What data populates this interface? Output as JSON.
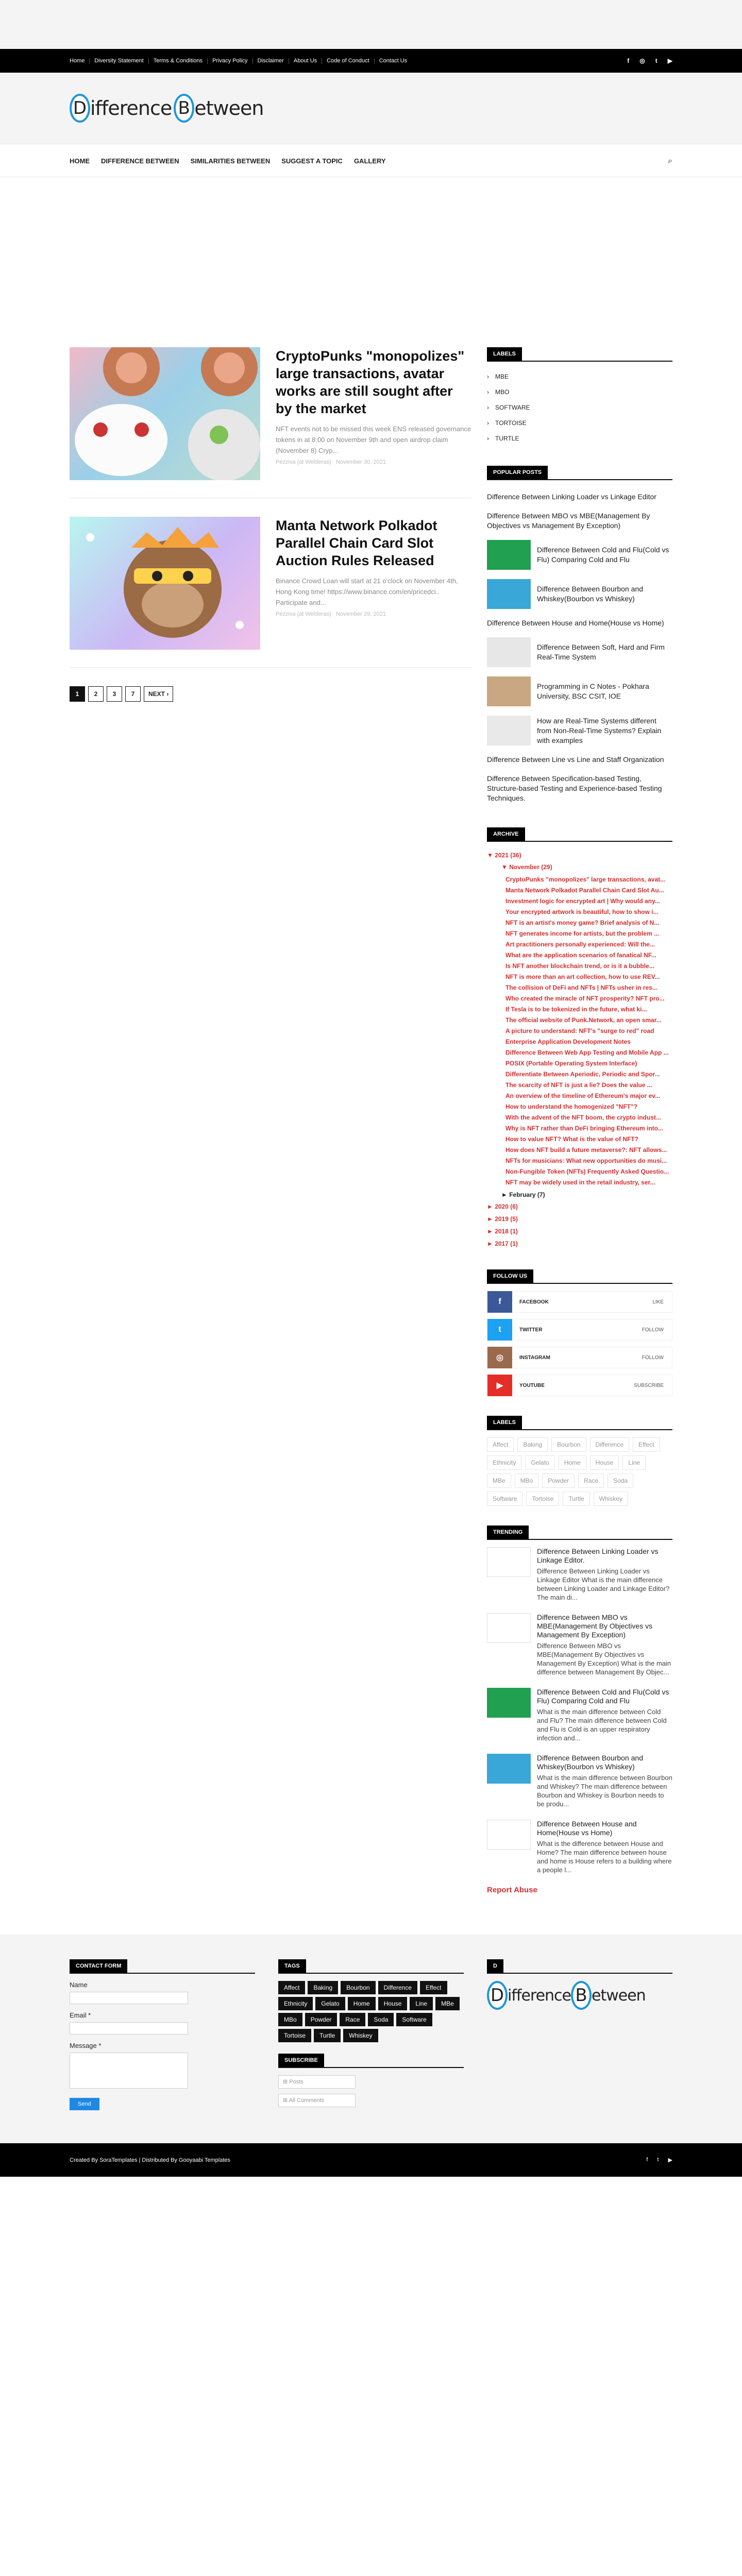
{
  "topnav": {
    "links": [
      "Home",
      "Diversity Statement",
      "Terms & Conditions",
      "Privacy Policy",
      "Disclaimer",
      "About Us",
      "Code of Conduct",
      "Contact Us"
    ],
    "social_icons": [
      "facebook-icon",
      "instagram-icon",
      "twitter-icon",
      "youtube-icon"
    ]
  },
  "logo": {
    "first_letter": "D",
    "first_rest": "ifference",
    "second_letter": "B",
    "second_rest": "etween"
  },
  "mainnav": {
    "items": [
      "Home",
      "Difference Between",
      "Similarities Between",
      "Suggest A Topic",
      "Gallery"
    ],
    "search_icon": "search-icon"
  },
  "posts": [
    {
      "title": "CryptoPunks \"monopolizes\" large transactions, avatar works are still sought after by the market",
      "snippet": "NFT events not to be missed this week ENS released governance tokens in at 8:00 on November 9th and open airdrop claim (November 8) Cryp...",
      "meta": "Pezziva (at Welderas) · November 30, 2021"
    },
    {
      "title": "Manta Network Polkadot Parallel Chain Card Slot Auction Rules Released",
      "snippet": "Binance Crowd Loan will start at 21 o'clock on November 4th, Hong Kong time! https://www.binance.com/en/pricedci.. Participate and...",
      "meta": "Pezziva (at Welderas) · November 29, 2021"
    }
  ],
  "pager": [
    "1",
    "2",
    "3",
    "7",
    "NEXT ›"
  ],
  "sidebar": {
    "labels_title": "Labels",
    "labels": [
      "MBE",
      "MBO",
      "SOFTWARE",
      "TORTOISE",
      "TURTLE"
    ],
    "popular_title": "Popular Posts",
    "popular": [
      "Difference Between Linking Loader vs Linkage Editor",
      "Difference Between MBO vs MBE(Management By Objectives vs Management By Exception)",
      "Difference Between Cold and Flu(Cold vs Flu) Comparing Cold and Flu",
      "Difference Between Bourbon and Whiskey(Bourbon vs Whiskey)",
      "Difference Between House and Home(House vs Home)",
      "Difference Between Soft, Hard and Firm Real-Time System",
      "Programming in C Notes - Pokhara University, BSC CSIT, IOE",
      "How are Real-Time Systems different from Non-Real-Time Systems? Explain with examples",
      "Difference Between Line vs Line and Staff Organization",
      "Difference Between Specification-based Testing, Structure-based Testing and Experience-based Testing Techniques."
    ],
    "archive_title": "Archive",
    "archive_2021": "▼  2021 (36)",
    "archive_nov": "▼  November (29)",
    "archive_posts": [
      "CryptoPunks \"monopolizes\" large transactions, avat...",
      "Manta Network Polkadot Parallel Chain Card Slot Au...",
      "Investment logic for encrypted art | Why would any...",
      "Your encrypted artwork is beautiful, how to show i...",
      "NFT is an artist's money game? Brief analysis of N...",
      "NFT generates income for artists, but the problem ...",
      "Art practitioners personally experienced: Will the...",
      "What are the application scenarios of fanatical NF...",
      "Is NFT another blockchain trend, or is it a bubble...",
      "NFT is more than an art collection, how to use REV...",
      "The collision of DeFi and NFTs | NFTs usher in res...",
      "Who created the miracle of NFT prosperity? NFT pro...",
      "If Tesla is to be tokenized in the future, what ki...",
      "The official website of Punk.Network, an open smar...",
      "A picture to understand: NFT's \"surge to red\" road",
      "Enterprise Application Development Notes",
      "Difference Between Web App Testing and Mobile App ...",
      "POSIX (Portable Operating System Interface)",
      "Differentiate Between Aperiodic, Periodic and Spor...",
      "The scarcity of NFT is just a lie? Does the value ...",
      "An overview of the timeline of Ethereum's major ev...",
      "How to understand the homogenized \"NFT\"?",
      "With the advent of the NFT boom, the crypto indust...",
      "Why is NFT rather than DeFi bringing Ethereum into...",
      "How to value NFT? What is the value of NFT?",
      "How does NFT build a future metaverse?: NFT allows...",
      "NFTs for musicians: What new opportunities do musi...",
      "Non-Fungible Token (NFTs) Frequently Asked Questio...",
      "NFT may be widely used in the retail industry, ser..."
    ],
    "archive_feb": "►  February (7)",
    "archive_years": [
      "►  2020 (6)",
      "►  2019 (5)",
      "►  2018 (1)",
      "►  2017 (1)"
    ],
    "follow_title": "Follow Us",
    "follow": [
      {
        "name": "FACEBOOK",
        "action": "LIKE",
        "icon": "facebook-icon",
        "glyph": "f",
        "color": "#3b5998"
      },
      {
        "name": "TWITTER",
        "action": "FOLLOW",
        "icon": "twitter-icon",
        "glyph": "t",
        "color": "#1da1f2"
      },
      {
        "name": "INSTAGRAM",
        "action": "FOLLOW",
        "icon": "instagram-icon",
        "glyph": "◎",
        "color": "#9b6a4d"
      },
      {
        "name": "YOUTUBE",
        "action": "SUBSCRIBE",
        "icon": "youtube-icon",
        "glyph": "▶",
        "color": "#e52d27"
      }
    ],
    "labels2_title": "Labels",
    "tags": [
      "Affect",
      "Baking",
      "Bourbon",
      "Difference",
      "Effect",
      "Ethnicity",
      "Gelato",
      "Home",
      "House",
      "Line",
      "MBe",
      "MBo",
      "Powder",
      "Race",
      "Soda",
      "Software",
      "Tortoise",
      "Turtle",
      "Whiskey"
    ],
    "trending_title": "Trending",
    "trending": [
      {
        "title": "Difference Between Linking Loader vs Linkage Editor.",
        "text": "Difference Between Linking Loader vs Linkage Editor     What is the main difference between Linking Loader and Linkage Editor? The main di..."
      },
      {
        "title": "Difference Between MBO vs MBE(Management By Objectives vs Management By Exception)",
        "text": "Difference Between MBO vs MBE(Management By Objectives vs Management By Exception)   What is the main difference between Management By Objec..."
      },
      {
        "title": "Difference Between Cold and Flu(Cold vs Flu) Comparing Cold and Flu",
        "text": "What is the main difference between Cold and Flu? The main difference between Cold and Flu is Cold is an upper respiratory infection and..."
      },
      {
        "title": "Difference Between Bourbon and Whiskey(Bourbon vs Whiskey)",
        "text": "What is the main difference between Bourbon and Whiskey? The main difference between Bourbon and Whiskey is Bourbon needs to be produ..."
      },
      {
        "title": "Difference Between House and Home(House vs Home)",
        "text": "What is the difference between House and Home? The main difference between house and home is House refers to a building where a people l..."
      }
    ],
    "report_abuse": "Report Abuse"
  },
  "footer": {
    "contact_title": "Contact Form",
    "name_label": "Name",
    "email_label": "Email *",
    "message_label": "Message *",
    "send": "Send",
    "tags_title": "Tags",
    "subscribe_title": "Subscribe",
    "posts_select": "Posts",
    "comments_select": "All Comments",
    "logo_title": "D"
  },
  "bottombar": {
    "credit": "Created By SoraTemplates | Distributed By Gooyaabi Templates"
  }
}
